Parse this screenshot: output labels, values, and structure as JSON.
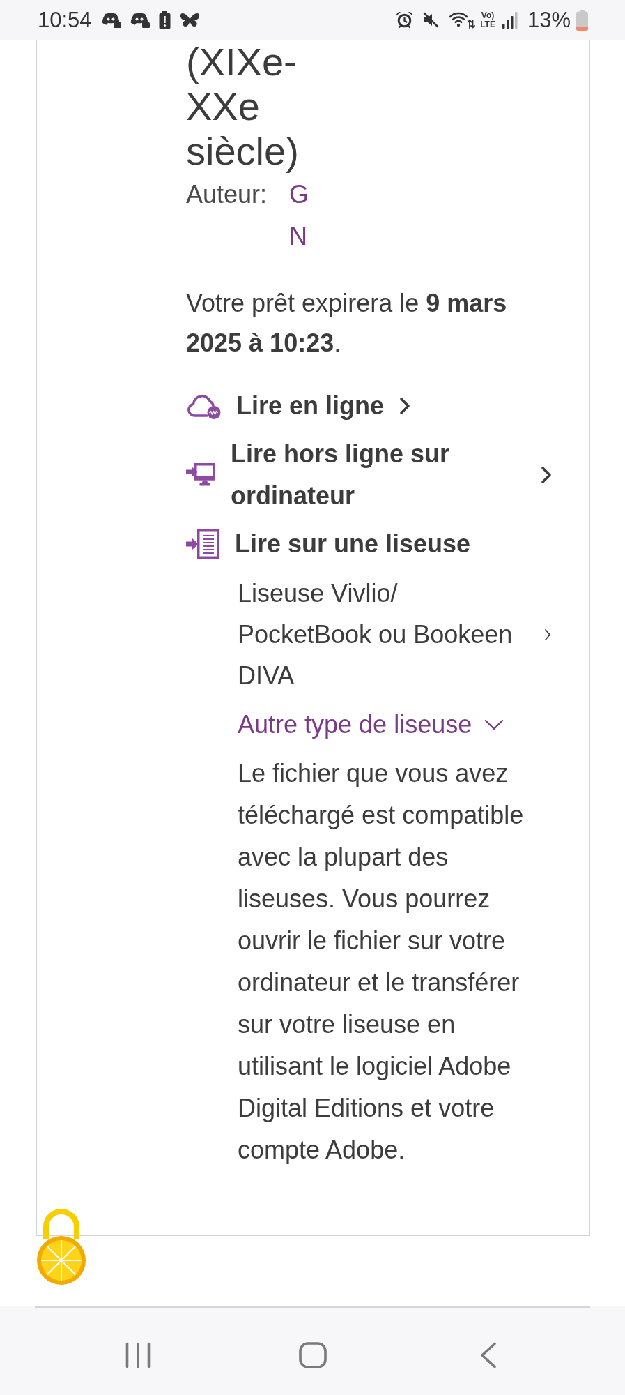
{
  "status_bar": {
    "time": "10:54",
    "network_type": [
      "Vo)",
      "LTE"
    ],
    "battery_percent": "13%"
  },
  "book": {
    "title": "(XIXe-XXe siècle)",
    "author_label": "Auteur:",
    "author_name_lines": [
      "G",
      "N"
    ]
  },
  "loan_notice": "Votre prêt expirera le **9 mars 2025 à 10:23**.",
  "reading_options": [
    {
      "kind": "link",
      "label": "Lire en ligne"
    },
    {
      "kind": "link",
      "label": "Lire hors ligne sur ordinateur"
    },
    {
      "kind": "heading",
      "label": "Lire sur une liseuse"
    }
  ],
  "ereader_options": [
    {
      "kind": "link",
      "label": "Liseuse Vivlio/ PocketBook ou Bookeen DIVA"
    },
    {
      "kind": "disclosure",
      "label": "Autre type de liseuse",
      "expanded": true,
      "description": "Le fichier que vous avez téléchargé est compatible avec la plupart des liseuses. Vous pourrez ouvrir le fichier sur votre ordinateur et le transférer sur votre liseuse en utilisant le logiciel Adobe Digital Editions et votre compte Adobe."
    }
  ]
}
